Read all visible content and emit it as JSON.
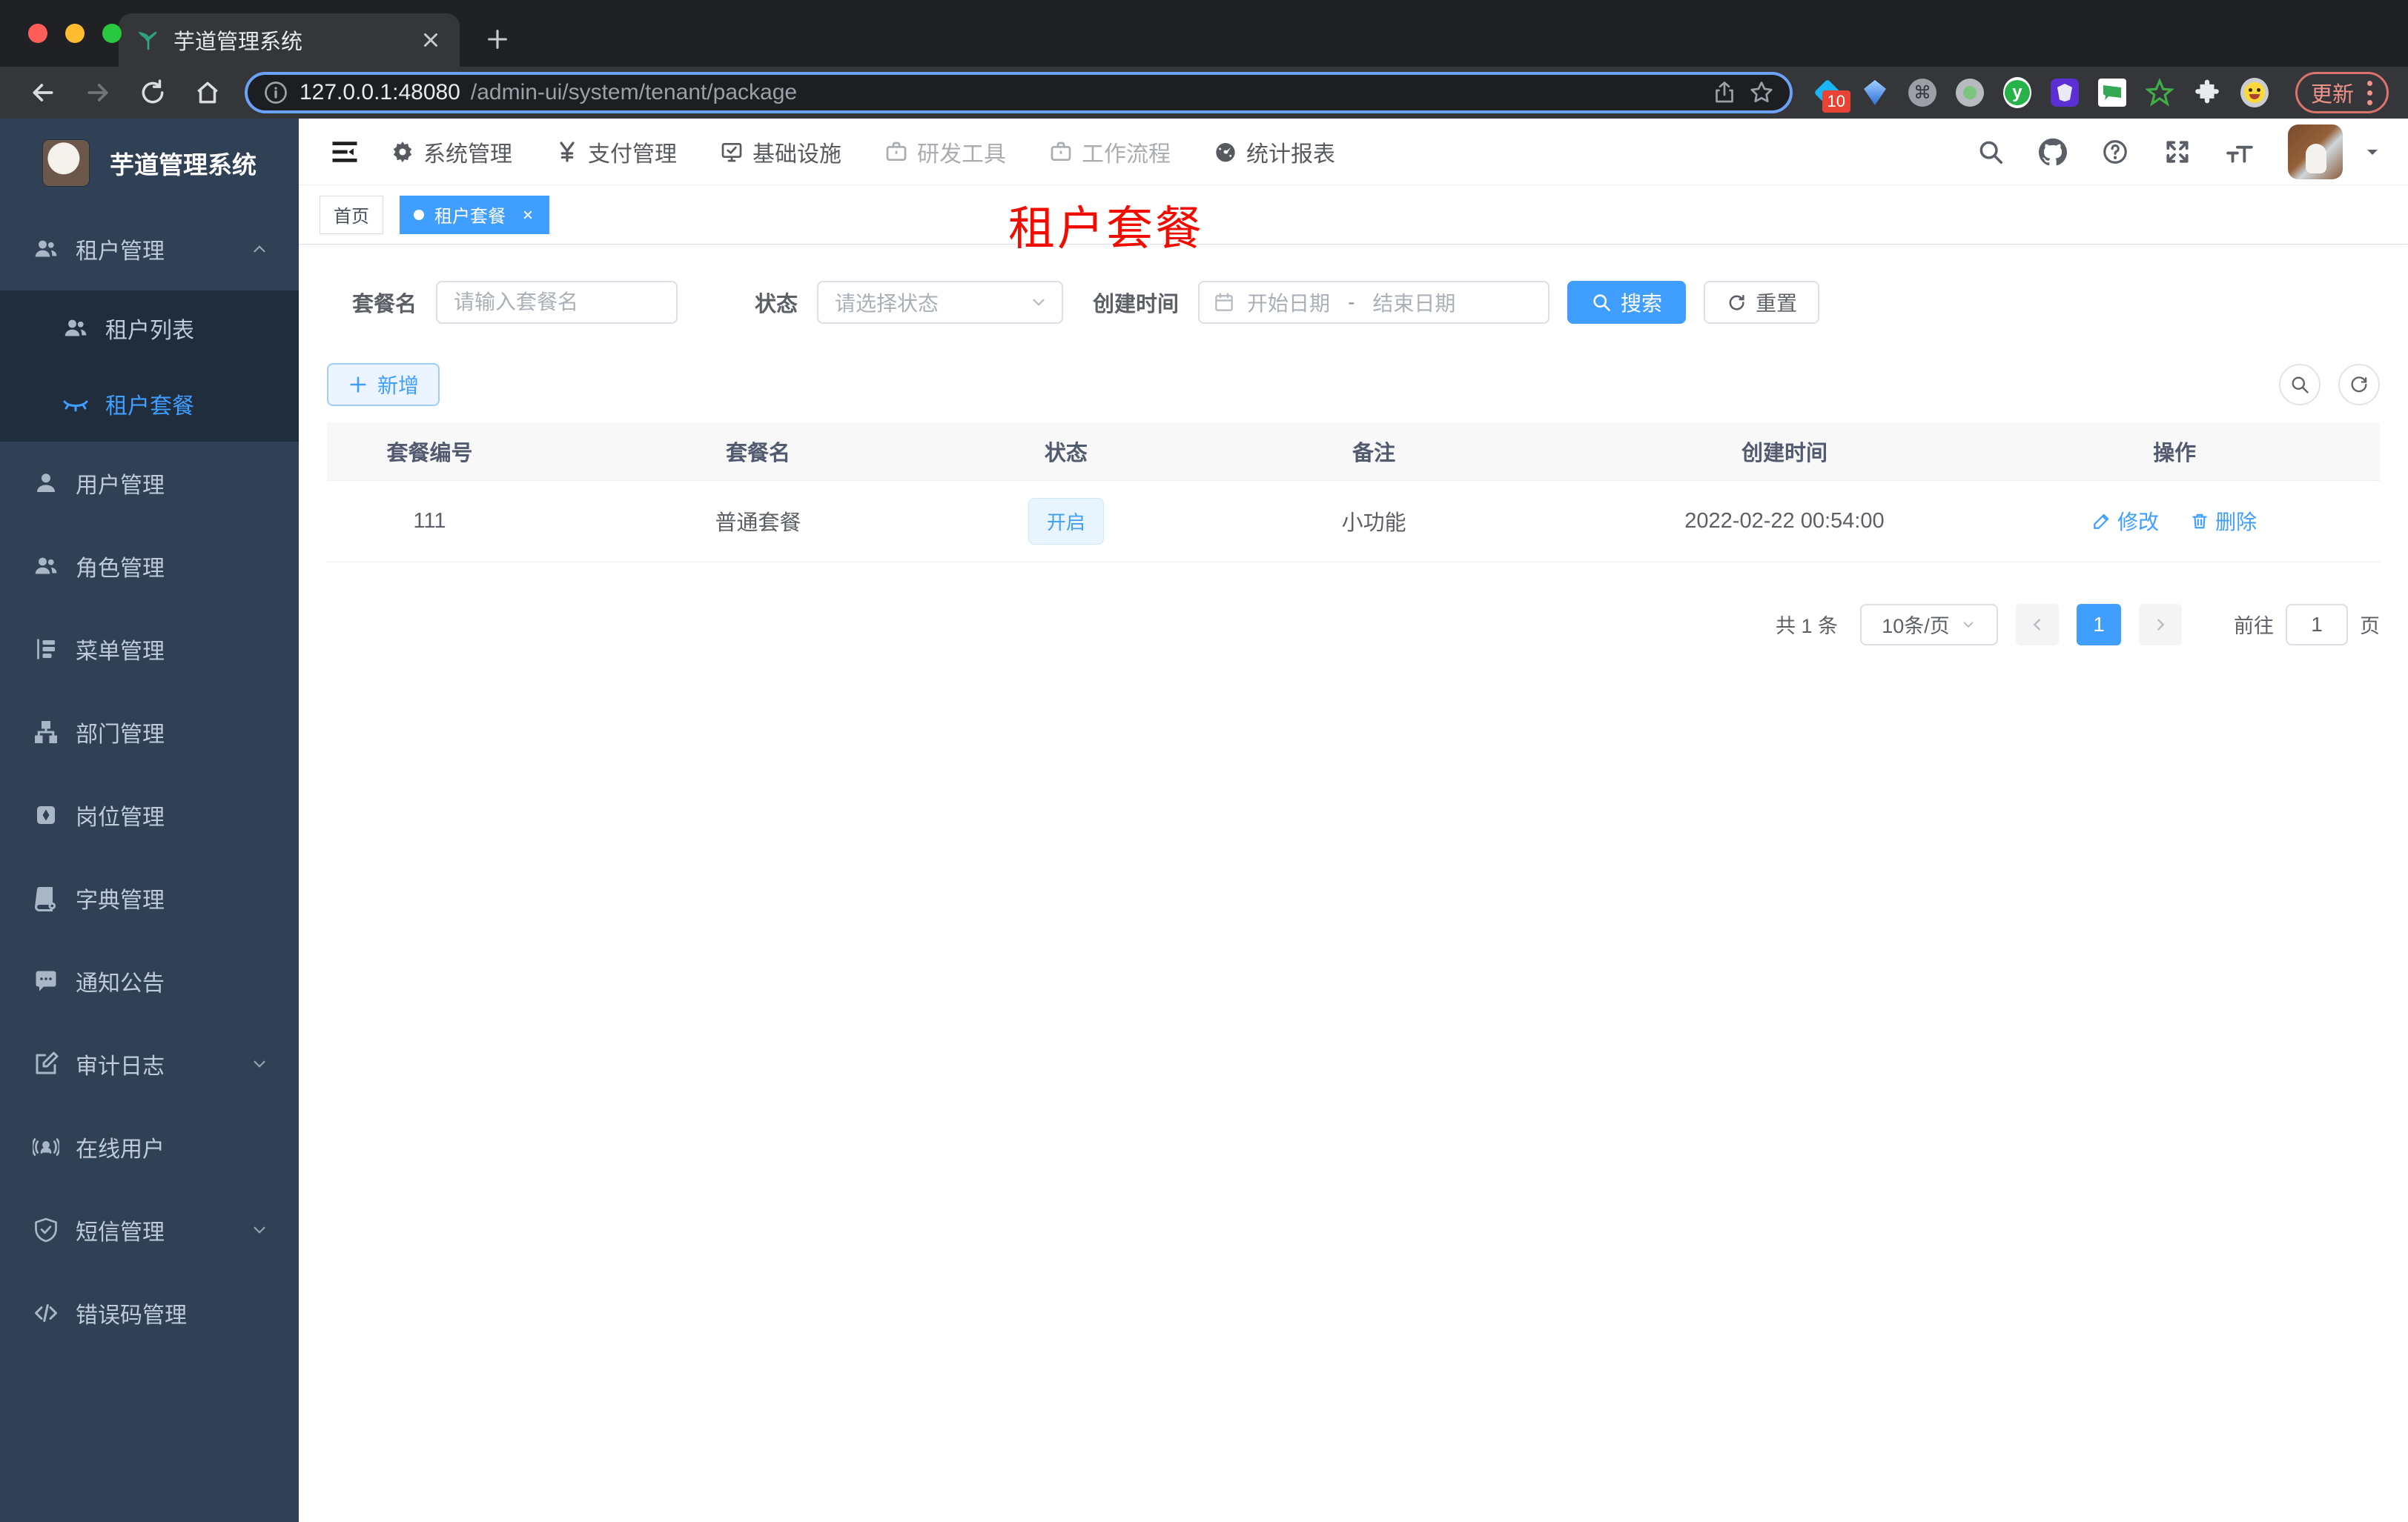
{
  "browser": {
    "tab_title": "芋道管理系统",
    "url_host": "127.0.0.1:48080",
    "url_path": "/admin-ui/system/tenant/package",
    "extension_badge": "10",
    "update_label": "更新"
  },
  "header": {
    "nav": [
      {
        "label": "系统管理"
      },
      {
        "label": "支付管理"
      },
      {
        "label": "基础设施"
      },
      {
        "label": "研发工具"
      },
      {
        "label": "工作流程"
      },
      {
        "label": "统计报表"
      }
    ]
  },
  "sidebar": {
    "title": "芋道管理系统",
    "items": [
      {
        "label": "租户管理"
      },
      {
        "label": "租户列表"
      },
      {
        "label": "租户套餐"
      },
      {
        "label": "用户管理"
      },
      {
        "label": "角色管理"
      },
      {
        "label": "菜单管理"
      },
      {
        "label": "部门管理"
      },
      {
        "label": "岗位管理"
      },
      {
        "label": "字典管理"
      },
      {
        "label": "通知公告"
      },
      {
        "label": "审计日志"
      },
      {
        "label": "在线用户"
      },
      {
        "label": "短信管理"
      },
      {
        "label": "错误码管理"
      }
    ]
  },
  "tags": {
    "home": "首页",
    "active": "租户套餐"
  },
  "annotation": {
    "text": "租户套餐"
  },
  "filters": {
    "name_label": "套餐名",
    "name_placeholder": "请输入套餐名",
    "status_label": "状态",
    "status_placeholder": "请选择状态",
    "date_label": "创建时间",
    "date_start_placeholder": "开始日期",
    "date_separator": "-",
    "date_end_placeholder": "结束日期",
    "search_label": "搜索",
    "reset_label": "重置"
  },
  "toolbar": {
    "add_label": "新增"
  },
  "table": {
    "headers": [
      "套餐编号",
      "套餐名",
      "状态",
      "备注",
      "创建时间",
      "操作"
    ],
    "rows": [
      {
        "id": "111",
        "name": "普通套餐",
        "status": "开启",
        "remark": "小功能",
        "created": "2022-02-22 00:54:00",
        "edit_label": "修改",
        "delete_label": "删除"
      }
    ]
  },
  "pagination": {
    "total": "共 1 条",
    "page_size": "10条/页",
    "current_page": "1",
    "goto_label": "前往",
    "goto_value": "1",
    "page_unit": "页"
  },
  "colors": {
    "accent": "#409eff",
    "sidebar_bg": "#304156",
    "submenu_bg": "#1f2d3d",
    "annotation_red": "#f20c00"
  }
}
